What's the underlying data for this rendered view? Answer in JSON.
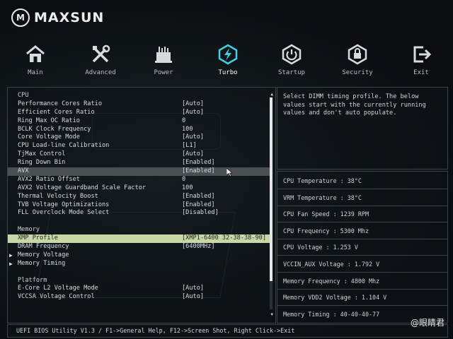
{
  "brand": {
    "logo_text": "MAXSUN",
    "mark": "M"
  },
  "nav": [
    {
      "label": "Main",
      "icon": "house-icon"
    },
    {
      "label": "Advanced",
      "icon": "tools-icon"
    },
    {
      "label": "Power",
      "icon": "chip-icon"
    },
    {
      "label": "Turbo",
      "icon": "lightning-icon",
      "active": true
    },
    {
      "label": "Startup",
      "icon": "power-icon"
    },
    {
      "label": "Security",
      "icon": "shield-icon"
    },
    {
      "label": "Exit",
      "icon": "exit-icon"
    }
  ],
  "settings": {
    "rows": [
      {
        "label": "CPU",
        "value": "",
        "type": "section"
      },
      {
        "label": "Performance Cores Ratio",
        "value": "[Auto]"
      },
      {
        "label": "Efficient Cores Ratio",
        "value": "[Auto]"
      },
      {
        "label": "Ring Max OC Ratio",
        "value": "0"
      },
      {
        "label": "BCLK Clock Frequency",
        "value": "100"
      },
      {
        "label": "Core Voltage Mode",
        "value": "[Auto]"
      },
      {
        "label": "CPU Load-line Calibration",
        "value": "[L1]"
      },
      {
        "label": "TjMax Control",
        "value": "[Auto]"
      },
      {
        "label": "Ring Down Bin",
        "value": "[Enabled]"
      },
      {
        "label": "AVX",
        "value": "[Enabled]",
        "type": "highlight"
      },
      {
        "label": "AVX2 Ratio Offset",
        "value": "0"
      },
      {
        "label": "AVX2 Voltage Guardband Scale Factor",
        "value": "100"
      },
      {
        "label": "Thermal Velocity Boost",
        "value": "[Enabled]"
      },
      {
        "label": "TVB Voltage Optimizations",
        "value": "[Enabled]"
      },
      {
        "label": "FLL Overclock Mode Select",
        "value": "[Disabled]"
      },
      {
        "label": "",
        "value": "",
        "type": "blank"
      },
      {
        "label": "Memory",
        "value": "",
        "type": "section"
      },
      {
        "label": "XMP Profile",
        "value": "[XMP1-6400 32-38-38-90]",
        "type": "selected"
      },
      {
        "label": "DRAM Frequency",
        "value": "[6400MHz]"
      },
      {
        "label": "Memory Voltage",
        "value": "",
        "type": "arrow"
      },
      {
        "label": "Memory Timing",
        "value": "",
        "type": "arrow"
      },
      {
        "label": "",
        "value": "",
        "type": "blank"
      },
      {
        "label": "Platform",
        "value": "",
        "type": "section"
      },
      {
        "label": "E-Core L2 Voltage Mode",
        "value": "[Auto]"
      },
      {
        "label": "VCCSA Voltage Control",
        "value": "[Auto]"
      }
    ],
    "scroll_position": 0.0
  },
  "help": {
    "text": "Select DIMM timing profile. The below values start with the currently running values and don't auto populate."
  },
  "stats": [
    {
      "text": "CPU Temperature : 38°C"
    },
    {
      "text": "VRM Temperature : 38°C"
    },
    {
      "text": "CPU Fan Speed : 1239 RPM"
    },
    {
      "text": "CPU Frequency : 5300 Mhz"
    },
    {
      "text": "CPU Voltage : 1.253 V"
    },
    {
      "text": "VCCIN_AUX Voltage : 1.792 V"
    },
    {
      "text": "Memory Frequency : 4800 Mhz"
    },
    {
      "text": "Memory VDD2 Voltage : 1.104 V"
    },
    {
      "text": "Memory Timing : 40-40-40-77"
    }
  ],
  "footer": {
    "text": "UEFI BIOS Utility V1.3 / F1->General Help, F12->Screen Shot, Right Click->Exit"
  },
  "watermark": "@眼睛君",
  "colors": {
    "selected_bg": "#c9d6a6",
    "highlight_bg": "#4a4f52",
    "border": "#3a4448"
  }
}
